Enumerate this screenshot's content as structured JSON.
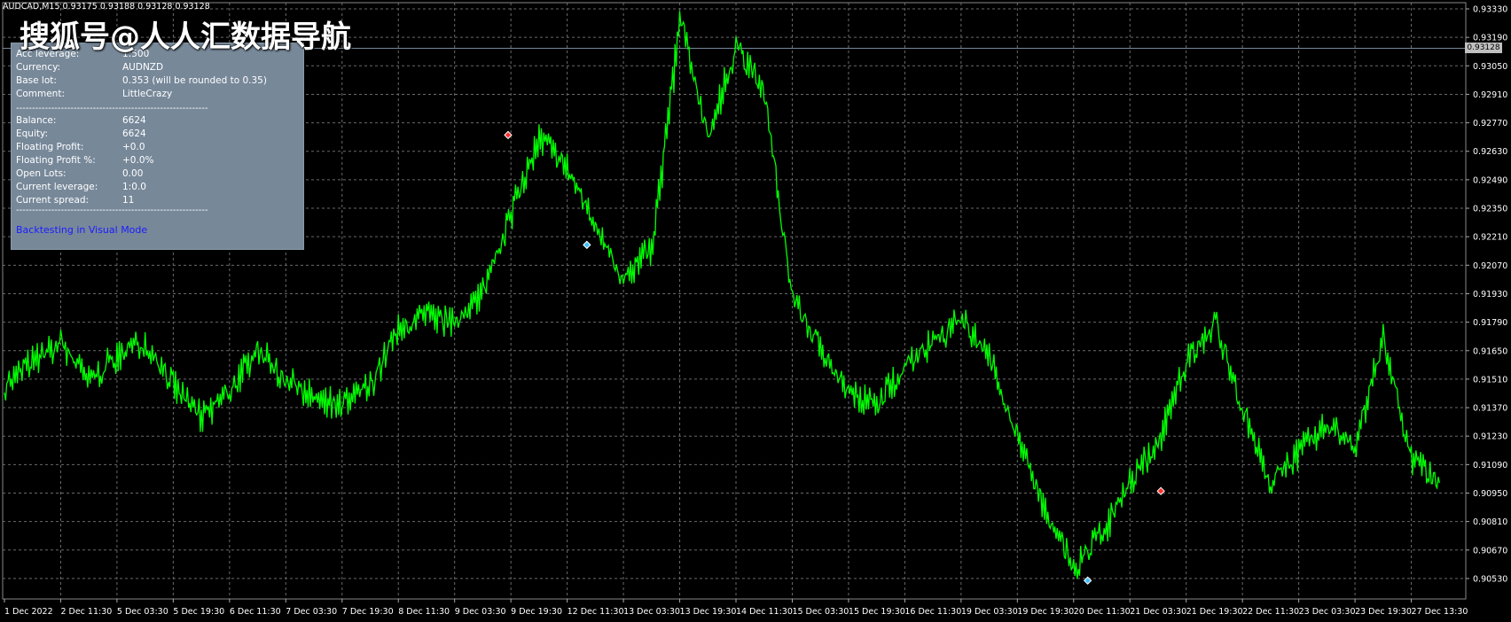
{
  "symbol_info": "AUDCAD,M15  0.93175 0.93188 0.93128 0.93128",
  "watermark": "搜狐号@人人汇数据导航",
  "current_price_tag": "0.93128",
  "info_panel": {
    "rows_top": [
      {
        "label": "Acc leverage:",
        "value": "1:500"
      },
      {
        "label": "Currency:",
        "value": "AUDNZD"
      },
      {
        "label": "Base lot:",
        "value": "0.353 (will be rounded to 0.35)"
      },
      {
        "label": "Comment:",
        "value": "LittleCrazy"
      }
    ],
    "separator": "------------------------------------------------------------",
    "rows_bottom": [
      {
        "label": "Balance:",
        "value": "6624"
      },
      {
        "label": "Equity:",
        "value": "6624"
      },
      {
        "label": "Floating Profit:",
        "value": "+0.0"
      },
      {
        "label": "Floating Profit %:",
        "value": "+0.0%"
      },
      {
        "label": "Open Lots:",
        "value": "0.00"
      },
      {
        "label": "Current leverage:",
        "value": "1:0.0"
      },
      {
        "label": "Current spread:",
        "value": "11"
      }
    ],
    "link": "Backtesting in Visual Mode"
  },
  "colors": {
    "background": "#000000",
    "price_line": "#00ff00",
    "grid": "#6a6a6a",
    "panel": "#778899",
    "link": "#1c1cff"
  },
  "chart_data": {
    "type": "line",
    "title": "",
    "xlabel": "",
    "ylabel": "",
    "ylim": [
      0.9046,
      0.9333
    ],
    "y_ticks": [
      "0.93330",
      "0.93190",
      "0.93050",
      "0.92910",
      "0.92770",
      "0.92630",
      "0.92490",
      "0.92350",
      "0.92210",
      "0.92070",
      "0.91930",
      "0.91790",
      "0.91650",
      "0.91510",
      "0.91370",
      "0.91230",
      "0.91090",
      "0.90950",
      "0.90810",
      "0.90670",
      "0.90530"
    ],
    "x_ticks": [
      "1 Dec 2022",
      "2 Dec 11:30",
      "5 Dec 03:30",
      "5 Dec 19:30",
      "6 Dec 11:30",
      "7 Dec 03:30",
      "7 Dec 19:30",
      "8 Dec 11:30",
      "9 Dec 03:30",
      "9 Dec 19:30",
      "12 Dec 11:30",
      "13 Dec 03:30",
      "13 Dec 19:30",
      "14 Dec 11:30",
      "15 Dec 03:30",
      "15 Dec 19:30",
      "16 Dec 11:30",
      "19 Dec 03:30",
      "19 Dec 19:30",
      "20 Dec 11:30",
      "21 Dec 03:30",
      "21 Dec 19:30",
      "22 Dec 11:30",
      "23 Dec 03:30",
      "23 Dec 19:30",
      "27 Dec 13:30"
    ],
    "grid": true,
    "series": [
      {
        "x": [
          0,
          0.5,
          1,
          1.5,
          2,
          2.5,
          3,
          3.5,
          4,
          4.5,
          5,
          5.5,
          6,
          6.5,
          7,
          7.5,
          8,
          8.5,
          9,
          9.5,
          10,
          10.5,
          11,
          11.5,
          12,
          12.5,
          13,
          13.5,
          14,
          14.5,
          15,
          15.5,
          16,
          16.5,
          17,
          17.5,
          18,
          18.5,
          19,
          19.5,
          20,
          20.5,
          21,
          21.5,
          22,
          22.5,
          23,
          23.5,
          24,
          24.5,
          25,
          25.5
        ],
        "values": [
          0.9148,
          0.916,
          0.9168,
          0.915,
          0.9162,
          0.917,
          0.9148,
          0.9132,
          0.9145,
          0.9166,
          0.915,
          0.9142,
          0.9138,
          0.9148,
          0.9175,
          0.9182,
          0.9178,
          0.9195,
          0.9232,
          0.927,
          0.9255,
          0.9225,
          0.92,
          0.9215,
          0.9328,
          0.927,
          0.9315,
          0.929,
          0.919,
          0.9165,
          0.9145,
          0.9138,
          0.9158,
          0.917,
          0.918,
          0.9162,
          0.9122,
          0.9085,
          0.9058,
          0.9075,
          0.91,
          0.912,
          0.916,
          0.918,
          0.9135,
          0.91,
          0.9115,
          0.9128,
          0.912,
          0.917,
          0.9112,
          0.91
        ]
      }
    ],
    "markers": [
      {
        "x": 8.95,
        "y": 0.9271,
        "color": "#ff3030"
      },
      {
        "x": 10.35,
        "y": 0.9217,
        "color": "#40c0ff"
      },
      {
        "x": 19.25,
        "y": 0.9052,
        "color": "#40c0ff"
      },
      {
        "x": 20.55,
        "y": 0.9096,
        "color": "#ff3030"
      }
    ]
  }
}
